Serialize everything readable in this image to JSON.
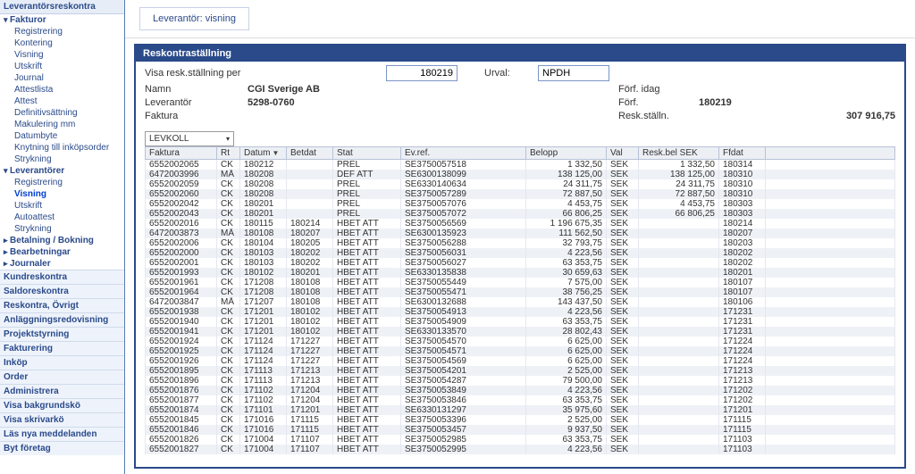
{
  "sidebar": {
    "header": "Leverantörsreskontra",
    "groups": [
      {
        "label": "Fakturor",
        "expanded": true,
        "items": [
          "Registrering",
          "Kontering",
          "Visning",
          "Utskrift",
          "Journal",
          "Attestlista",
          "Attest",
          "Definitivsättning",
          "Makulering mm",
          "Datumbyte",
          "Knytning till inköpsorder",
          "Strykning"
        ]
      },
      {
        "label": "Leverantörer",
        "expanded": true,
        "items": [
          "Registrering",
          "Visning",
          "Utskrift",
          "Autoattest",
          "Strykning"
        ],
        "active": "Visning"
      },
      {
        "label": "Betalning / Bokning",
        "expanded": false
      },
      {
        "label": "Bearbetningar",
        "expanded": false
      },
      {
        "label": "Journaler",
        "expanded": false
      }
    ],
    "cats": [
      "Kundreskontra",
      "Saldoreskontra",
      "Reskontra, Övrigt",
      "Anläggningsredovisning",
      "Projektstyrning",
      "Fakturering",
      "Inköp",
      "Order",
      "Administrera",
      "Visa bakgrundskö",
      "Visa skrivarkö",
      "Läs nya meddelanden",
      "Byt företag"
    ]
  },
  "breadcrumb": "Leverantör: visning",
  "panel": {
    "title": "Reskontraställning",
    "per_label": "Visa resk.ställning per",
    "per_value": "180219",
    "urval_label": "Urval:",
    "urval_value": "NPDH",
    "rows": [
      {
        "l": "Namn",
        "v": "CGI Sverige AB",
        "r": "Förf. idag",
        "rv": ""
      },
      {
        "l": "Leverantör",
        "v": "5298-0760",
        "r": "Förf.",
        "rv": "180219"
      },
      {
        "l": "Faktura",
        "v": "",
        "r": "Resk.ställn.",
        "rv": "",
        "amount": "307 916,75"
      }
    ],
    "dropdown": "LEVKOLL"
  },
  "grid": {
    "cols": [
      "Faktura",
      "Rt",
      "Datum",
      "Betdat",
      "Stat",
      "Ev.ref.",
      "Belopp",
      "Val",
      "Resk.bel SEK",
      "Ffdat"
    ],
    "rows": [
      [
        "6552002065",
        "CK",
        "180212",
        "",
        "PREL",
        "SE3750057518",
        "1 332,50",
        "SEK",
        "1 332,50",
        "180314"
      ],
      [
        "6472003996",
        "MÅ",
        "180208",
        "",
        "DEF ATT",
        "SE6300138099",
        "138 125,00",
        "SEK",
        "138 125,00",
        "180310"
      ],
      [
        "6552002059",
        "CK",
        "180208",
        "",
        "PREL",
        "SE6330140634",
        "24 311,75",
        "SEK",
        "24 311,75",
        "180310"
      ],
      [
        "6552002060",
        "CK",
        "180208",
        "",
        "PREL",
        "SE3750057289",
        "72 887,50",
        "SEK",
        "72 887,50",
        "180310"
      ],
      [
        "6552002042",
        "CK",
        "180201",
        "",
        "PREL",
        "SE3750057076",
        "4 453,75",
        "SEK",
        "4 453,75",
        "180303"
      ],
      [
        "6552002043",
        "CK",
        "180201",
        "",
        "PREL",
        "SE3750057072",
        "66 806,25",
        "SEK",
        "66 806,25",
        "180303"
      ],
      [
        "6552002016",
        "CK",
        "180115",
        "180214",
        "HBET ATT",
        "SE3750056569",
        "1 196 675,35",
        "SEK",
        "",
        "180214"
      ],
      [
        "6472003873",
        "MÅ",
        "180108",
        "180207",
        "HBET ATT",
        "SE6300135923",
        "111 562,50",
        "SEK",
        "",
        "180207"
      ],
      [
        "6552002006",
        "CK",
        "180104",
        "180205",
        "HBET ATT",
        "SE3750056288",
        "32 793,75",
        "SEK",
        "",
        "180203"
      ],
      [
        "6552002000",
        "CK",
        "180103",
        "180202",
        "HBET ATT",
        "SE3750056031",
        "4 223,56",
        "SEK",
        "",
        "180202"
      ],
      [
        "6552002001",
        "CK",
        "180103",
        "180202",
        "HBET ATT",
        "SE3750056027",
        "63 353,75",
        "SEK",
        "",
        "180202"
      ],
      [
        "6552001993",
        "CK",
        "180102",
        "180201",
        "HBET ATT",
        "SE6330135838",
        "30 659,63",
        "SEK",
        "",
        "180201"
      ],
      [
        "6552001961",
        "CK",
        "171208",
        "180108",
        "HBET ATT",
        "SE3750055449",
        "7 575,00",
        "SEK",
        "",
        "180107"
      ],
      [
        "6552001964",
        "CK",
        "171208",
        "180108",
        "HBET ATT",
        "SE3750055471",
        "38 756,25",
        "SEK",
        "",
        "180107"
      ],
      [
        "6472003847",
        "MÅ",
        "171207",
        "180108",
        "HBET ATT",
        "SE6300132688",
        "143 437,50",
        "SEK",
        "",
        "180106"
      ],
      [
        "6552001938",
        "CK",
        "171201",
        "180102",
        "HBET ATT",
        "SE3750054913",
        "4 223,56",
        "SEK",
        "",
        "171231"
      ],
      [
        "6552001940",
        "CK",
        "171201",
        "180102",
        "HBET ATT",
        "SE3750054909",
        "63 353,75",
        "SEK",
        "",
        "171231"
      ],
      [
        "6552001941",
        "CK",
        "171201",
        "180102",
        "HBET ATT",
        "SE6330133570",
        "28 802,43",
        "SEK",
        "",
        "171231"
      ],
      [
        "6552001924",
        "CK",
        "171124",
        "171227",
        "HBET ATT",
        "SE3750054570",
        "6 625,00",
        "SEK",
        "",
        "171224"
      ],
      [
        "6552001925",
        "CK",
        "171124",
        "171227",
        "HBET ATT",
        "SE3750054571",
        "6 625,00",
        "SEK",
        "",
        "171224"
      ],
      [
        "6552001926",
        "CK",
        "171124",
        "171227",
        "HBET ATT",
        "SE3750054569",
        "6 625,00",
        "SEK",
        "",
        "171224"
      ],
      [
        "6552001895",
        "CK",
        "171113",
        "171213",
        "HBET ATT",
        "SE3750054201",
        "2 525,00",
        "SEK",
        "",
        "171213"
      ],
      [
        "6552001896",
        "CK",
        "171113",
        "171213",
        "HBET ATT",
        "SE3750054287",
        "79 500,00",
        "SEK",
        "",
        "171213"
      ],
      [
        "6552001876",
        "CK",
        "171102",
        "171204",
        "HBET ATT",
        "SE3750053849",
        "4 223,56",
        "SEK",
        "",
        "171202"
      ],
      [
        "6552001877",
        "CK",
        "171102",
        "171204",
        "HBET ATT",
        "SE3750053846",
        "63 353,75",
        "SEK",
        "",
        "171202"
      ],
      [
        "6552001874",
        "CK",
        "171101",
        "171201",
        "HBET ATT",
        "SE6330131297",
        "35 975,60",
        "SEK",
        "",
        "171201"
      ],
      [
        "6552001845",
        "CK",
        "171016",
        "171115",
        "HBET ATT",
        "SE3750053396",
        "2 525,00",
        "SEK",
        "",
        "171115"
      ],
      [
        "6552001846",
        "CK",
        "171016",
        "171115",
        "HBET ATT",
        "SE3750053457",
        "9 937,50",
        "SEK",
        "",
        "171115"
      ],
      [
        "6552001826",
        "CK",
        "171004",
        "171107",
        "HBET ATT",
        "SE3750052985",
        "63 353,75",
        "SEK",
        "",
        "171103"
      ],
      [
        "6552001827",
        "CK",
        "171004",
        "171107",
        "HBET ATT",
        "SE3750052995",
        "4 223,56",
        "SEK",
        "",
        "171103"
      ]
    ]
  }
}
